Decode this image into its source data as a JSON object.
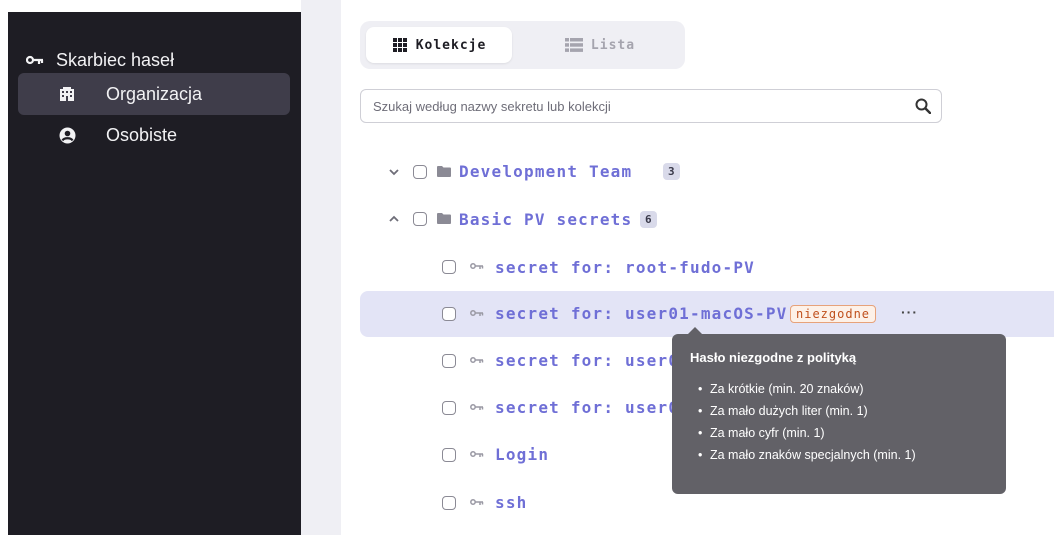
{
  "sidebar": {
    "title": "Skarbiec haseł",
    "items": [
      {
        "label": "Organizacja",
        "icon": "building-icon",
        "active": true
      },
      {
        "label": "Osobiste",
        "icon": "user-circle-icon",
        "active": false
      }
    ]
  },
  "tabs": [
    {
      "label": "Kolekcje",
      "icon": "grid-icon",
      "active": true
    },
    {
      "label": "Lista",
      "icon": "list-icon",
      "active": false
    }
  ],
  "search": {
    "placeholder": "Szukaj według nazwy sekretu lub kolekcji",
    "value": ""
  },
  "tree": {
    "collections": [
      {
        "name": "Development Team",
        "count": "3",
        "expanded": false
      },
      {
        "name": "Basic PV secrets",
        "count": "6",
        "expanded": true
      }
    ],
    "secrets": [
      {
        "name": "secret for: root-fudo-PV"
      },
      {
        "name": "secret for: user01-macOS-PV",
        "badge": "niezgodne",
        "more": "···"
      },
      {
        "name": "secret for: user01"
      },
      {
        "name": "secret for: user01"
      },
      {
        "name": "Login"
      },
      {
        "name": "ssh"
      }
    ]
  },
  "tooltip": {
    "title": "Hasło niezgodne z polityką",
    "items": [
      "Za krótkie (min. 20 znaków)",
      "Za mało dużych liter (min. 1)",
      "Za mało cyfr (min. 1)",
      "Za mało znaków specjalnych (min. 1)"
    ]
  },
  "colors": {
    "sidebar_bg": "#1e1d24",
    "active_item_bg": "#3f3d4a",
    "link": "#6f6fd6",
    "highlight_row": "#e3e4f6",
    "warning": "#c0501d",
    "tooltip_bg": "#626167"
  }
}
